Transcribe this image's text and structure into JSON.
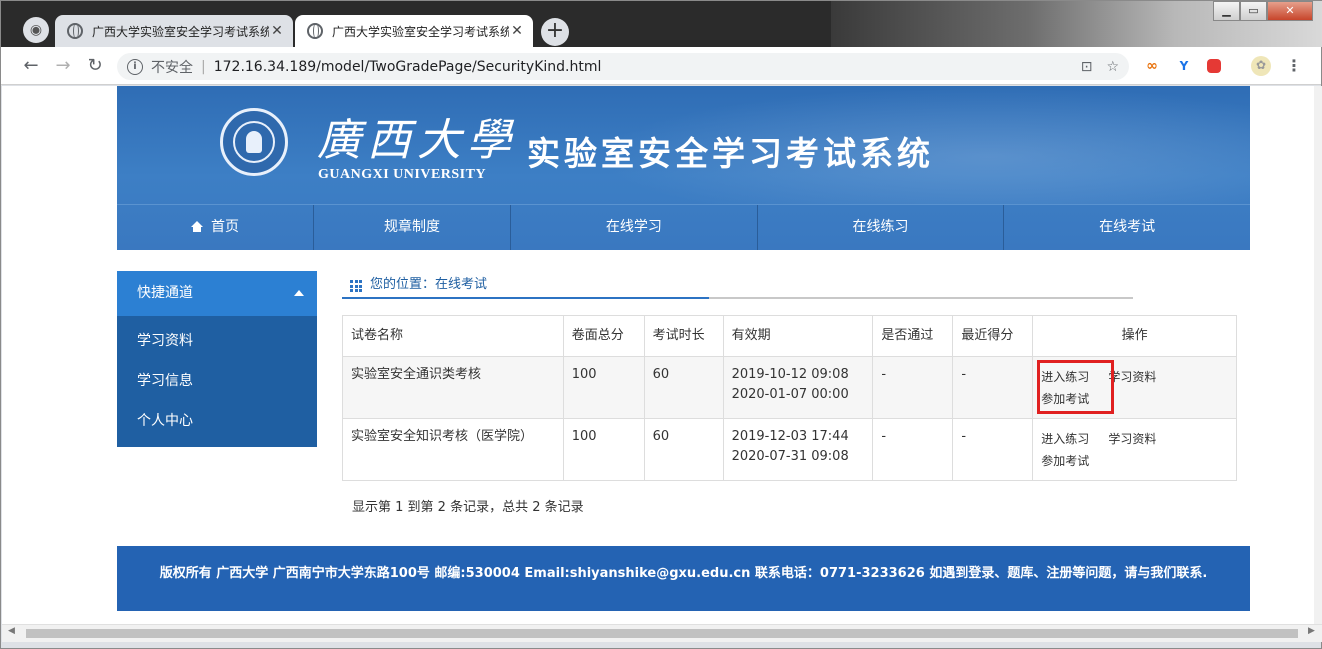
{
  "browser": {
    "tabs": [
      {
        "title": "广西大学实验室安全学习考试系统"
      },
      {
        "title": "广西大学实验室安全学习考试系统"
      }
    ],
    "address": {
      "security_label": "不安全",
      "url": "172.16.34.189/model/TwoGradePage/SecurityKind.html"
    }
  },
  "banner": {
    "university_cn": "廣西大學",
    "university_en": "GUANGXI UNIVERSITY",
    "system_title": "实验室安全学习考试系统"
  },
  "nav": {
    "items": [
      "首页",
      "规章制度",
      "在线学习",
      "在线练习",
      "在线考试"
    ]
  },
  "sidebar": {
    "header": "快捷通道",
    "items": [
      "学习资料",
      "学习信息",
      "个人中心"
    ]
  },
  "breadcrumb": {
    "text": "您的位置：在线考试"
  },
  "table": {
    "headers": [
      "试卷名称",
      "卷面总分",
      "考试时长",
      "有效期",
      "是否通过",
      "最近得分",
      "操作"
    ],
    "rows": [
      {
        "name": "实验室安全通识类考核",
        "score": "100",
        "duration": "60",
        "valid_from": "2019-10-12 09:08",
        "valid_to": "2020-01-07 00:00",
        "passed": "-",
        "recent": "-",
        "op_practice": "进入练习",
        "op_materials": "学习资料",
        "op_exam": "参加考试"
      },
      {
        "name": "实验室安全知识考核（医学院）",
        "score": "100",
        "duration": "60",
        "valid_from": "2019-12-03 17:44",
        "valid_to": "2020-07-31 09:08",
        "passed": "-",
        "recent": "-",
        "op_practice": "进入练习",
        "op_materials": "学习资料",
        "op_exam": "参加考试"
      }
    ]
  },
  "records_text": "显示第 1 到第 2 条记录，总共 2 条记录",
  "footer": {
    "text": "版权所有  广西大学 广西南宁市大学东路100号 邮编:530004 Email:shiyanshike@gxu.edu.cn 联系电话：0771-3233626 如遇到登录、题库、注册等问题，请与我们联系."
  }
}
